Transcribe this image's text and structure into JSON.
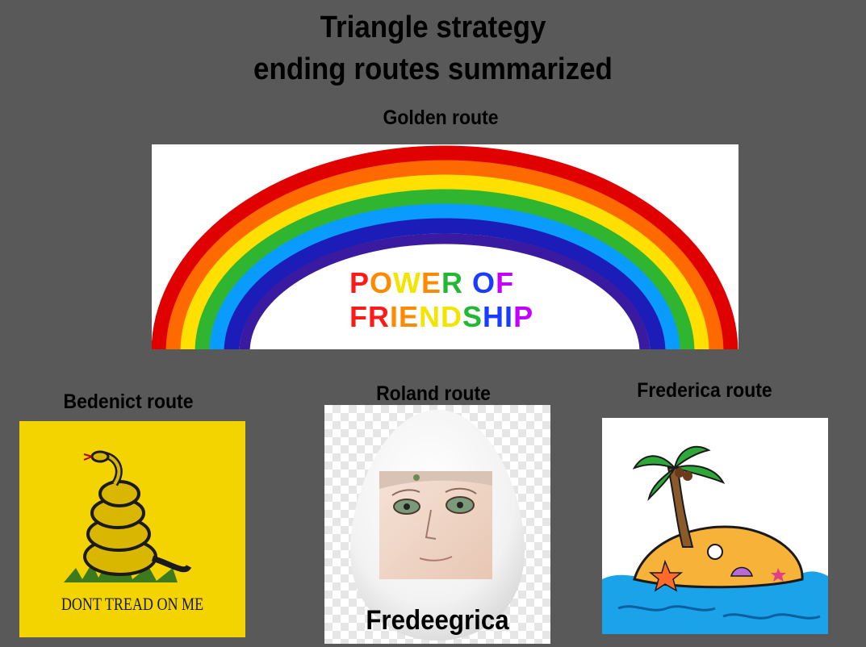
{
  "header": {
    "title_line1": "Triangle strategy",
    "title_line2": "ending routes summarized"
  },
  "golden": {
    "label": "Golden route",
    "image_text": {
      "line1": [
        "P",
        "O",
        "W",
        "E",
        "R",
        " ",
        "O",
        "F"
      ],
      "line2": [
        "F",
        "R",
        "I",
        "E",
        "N",
        "D",
        "S",
        "H",
        "I",
        "P"
      ]
    }
  },
  "bedenict": {
    "label": "Bedenict route",
    "flag_text": "DONT TREAD ON ME"
  },
  "roland": {
    "label": "Roland route",
    "caption": "Fredeegrica"
  },
  "frederica": {
    "label": "Frederica route"
  },
  "colors": {
    "background": "#595959",
    "rainbow": [
      "#e00000",
      "#ff6a00",
      "#ffd800",
      "#2fb52f",
      "#0a9bff",
      "#1c1cb8",
      "#3a1aa0"
    ],
    "flag_yellow": "#f3d400"
  }
}
